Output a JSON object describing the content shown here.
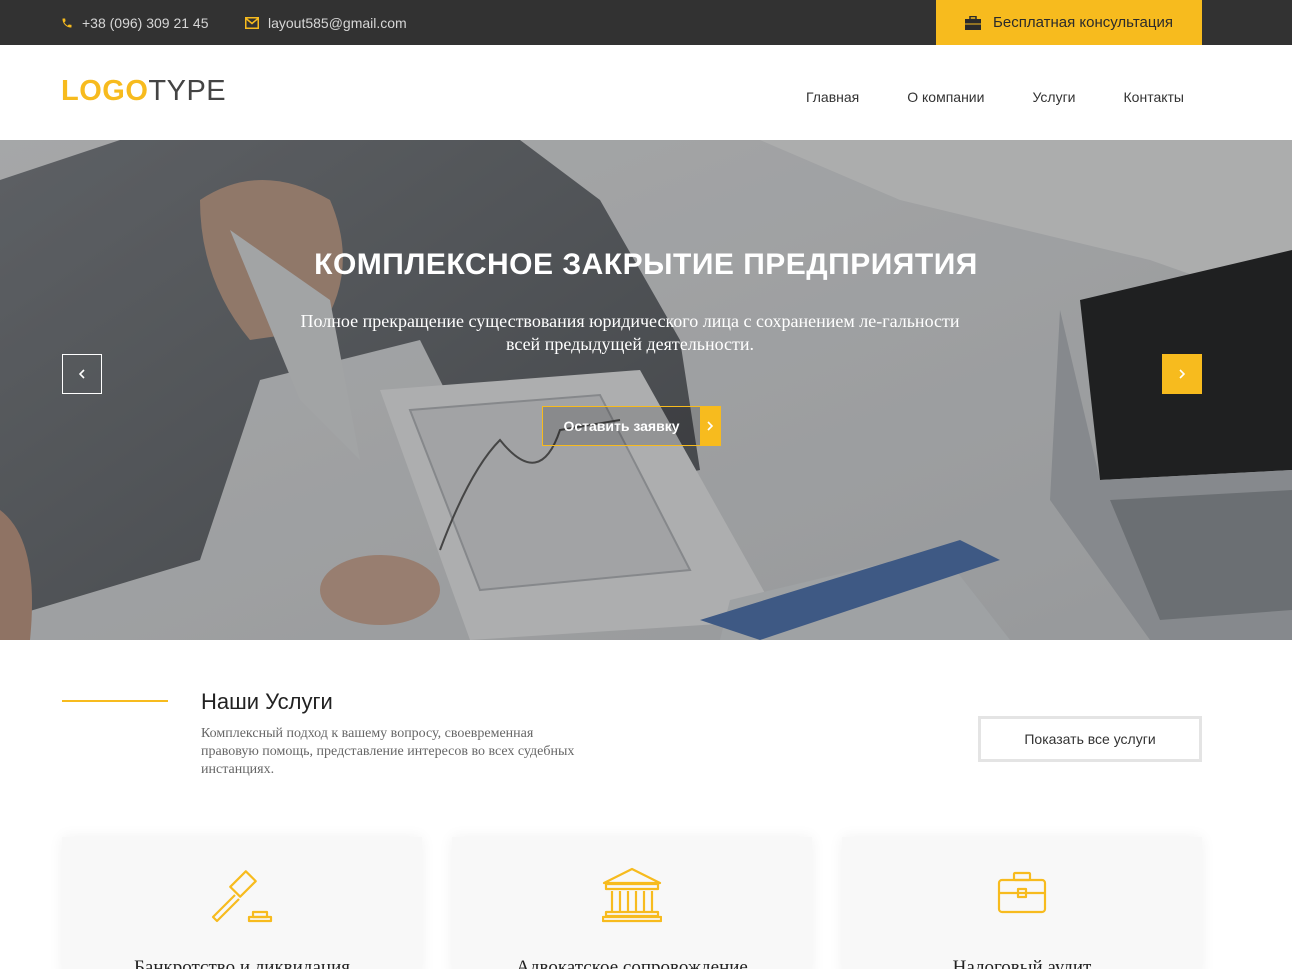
{
  "topbar": {
    "phone": "+38 (096) 309 21 45",
    "email": "layout585@gmail.com",
    "consult_label": "Бесплатная консультация"
  },
  "logo": {
    "part1": "LOGO",
    "part2": "TYPE"
  },
  "nav": {
    "items": [
      "Главная",
      "О компании",
      "Услуги",
      "Контакты"
    ]
  },
  "hero": {
    "title": "КОМПЛЕКСНОЕ ЗАКРЫТИЕ ПРЕДПРИЯТИЯ",
    "subtitle": "Полное прекращение существования юридического лица с сохранением ле-гальности всей предыдущей деятельности.",
    "cta_label": "Оставить заявку"
  },
  "services": {
    "title": "Наши Услуги",
    "description": "Комплексный подход к вашему вопросу, своевременная правовую помощь, представление интересов во всех судебных инстанциях.",
    "all_label": "Показать все услуги",
    "cards": [
      {
        "icon": "gavel-icon",
        "title": "Банкротство и ликвидация"
      },
      {
        "icon": "courthouse-icon",
        "title": "Адвокатское сопровождение"
      },
      {
        "icon": "briefcase-icon",
        "title": "Налоговый аудит"
      }
    ]
  },
  "colors": {
    "accent": "#f7bb1e",
    "topbar": "#323232"
  }
}
